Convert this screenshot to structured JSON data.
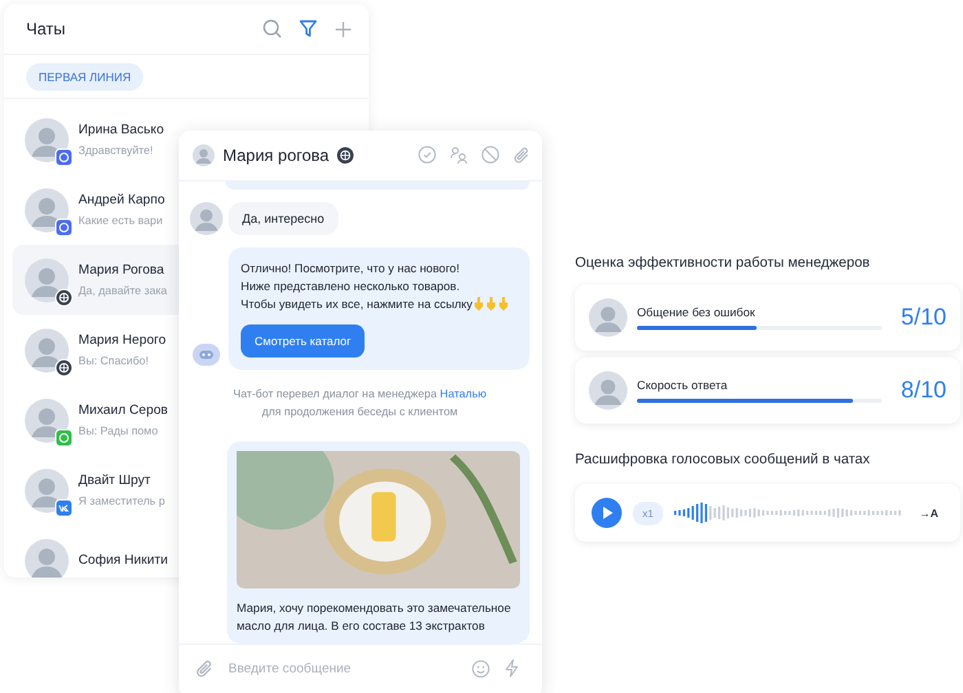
{
  "chat_list": {
    "title": "Чаты",
    "filter_tag": "ПЕРВАЯ ЛИНИЯ",
    "items": [
      {
        "name": "Ирина Васько",
        "preview": "Здравствуйте!",
        "kind": "messenger",
        "selected": false
      },
      {
        "name": "Андрей Карпо",
        "preview": "Какие есть вари",
        "kind": "messenger",
        "selected": false
      },
      {
        "name": "Мария Рогова",
        "preview": "Да, давайте зака",
        "kind": "web",
        "selected": true
      },
      {
        "name": "Мария Нерого",
        "preview": "Вы: Спасибо!",
        "kind": "web",
        "selected": false
      },
      {
        "name": "Михаил Серов",
        "preview": "Вы: Рады помо",
        "kind": "whatsapp",
        "selected": false
      },
      {
        "name": "Двайт Шрут",
        "preview": "Я заместитель р",
        "kind": "vk",
        "selected": false
      },
      {
        "name": "София Никити",
        "selected": false
      }
    ]
  },
  "chat_window": {
    "contact": "Мария рогова",
    "messages": [
      {
        "kind": "cut"
      },
      {
        "kind": "client",
        "text": "Да, интересно"
      },
      {
        "kind": "bot",
        "lines": [
          "Отлично! Посмотрите, что у нас нового!",
          "Ниже представлено несколько товаров.",
          "Чтобы увидеть их все, нажмите на ссылку"
        ],
        "button": "Смотреть каталог"
      },
      {
        "kind": "system",
        "before": "Чат-бот перевел диалог на менеджера",
        "link": "Наталью",
        "after": "для продолжения беседы с клиентом"
      },
      {
        "kind": "product",
        "text": "Мария, хочу порекомендовать это замечательное масло для лица. В его составе 13 экстрактов"
      }
    ],
    "composer": {
      "placeholder": "Введите сообщение"
    }
  },
  "ratings": {
    "title": "Оценка эффективности работы менеджеров",
    "items": [
      {
        "label": "Общение без ошибок",
        "level": 0.49,
        "score": "5/10"
      },
      {
        "label": "Скорость ответа",
        "level": 0.88,
        "score": "8/10"
      }
    ]
  },
  "voice": {
    "title": "Расшифровка голосовых сообщений в чатах",
    "speed": "x1",
    "transcribe": "→A"
  }
}
